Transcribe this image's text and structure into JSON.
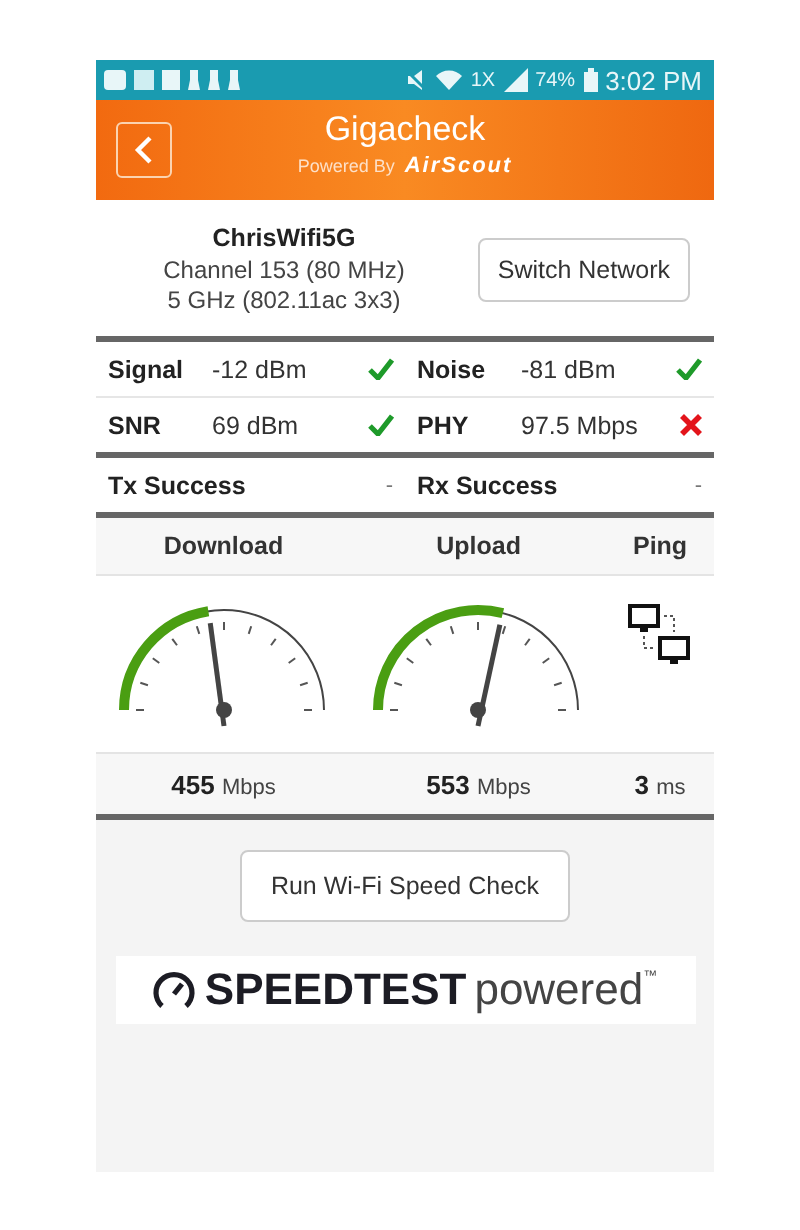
{
  "status_bar": {
    "network": "1X",
    "battery": "74%",
    "time": "3:02 PM"
  },
  "header": {
    "title": "Gigacheck",
    "subtitle": "Powered By",
    "brand": "AirScout"
  },
  "network": {
    "ssid": "ChrisWifi5G",
    "channel": "Channel 153 (80 MHz)",
    "band": "5 GHz (802.11ac 3x3)",
    "button": "Switch Network"
  },
  "metrics": [
    {
      "label": "Signal",
      "value": "-12 dBm",
      "ok": true
    },
    {
      "label": "Noise",
      "value": "-81 dBm",
      "ok": true
    },
    {
      "label": "SNR",
      "value": "69 dBm",
      "ok": true
    },
    {
      "label": "PHY",
      "value": "97.5 Mbps",
      "ok": false
    }
  ],
  "success": [
    {
      "label": "Tx Success",
      "value": "-"
    },
    {
      "label": "Rx Success",
      "value": "-"
    }
  ],
  "speed": [
    {
      "kind": "gauge",
      "label": "Download",
      "value": "455",
      "unit": "Mbps"
    },
    {
      "kind": "gauge",
      "label": "Upload",
      "value": "553",
      "unit": "Mbps"
    },
    {
      "kind": "ping",
      "label": "Ping",
      "value": "3",
      "unit": "ms"
    }
  ],
  "run_button": "Run Wi-Fi Speed Check",
  "speedtest": {
    "name": "SPEEDTEST",
    "tagline": "powered$^{™}$"
  }
}
